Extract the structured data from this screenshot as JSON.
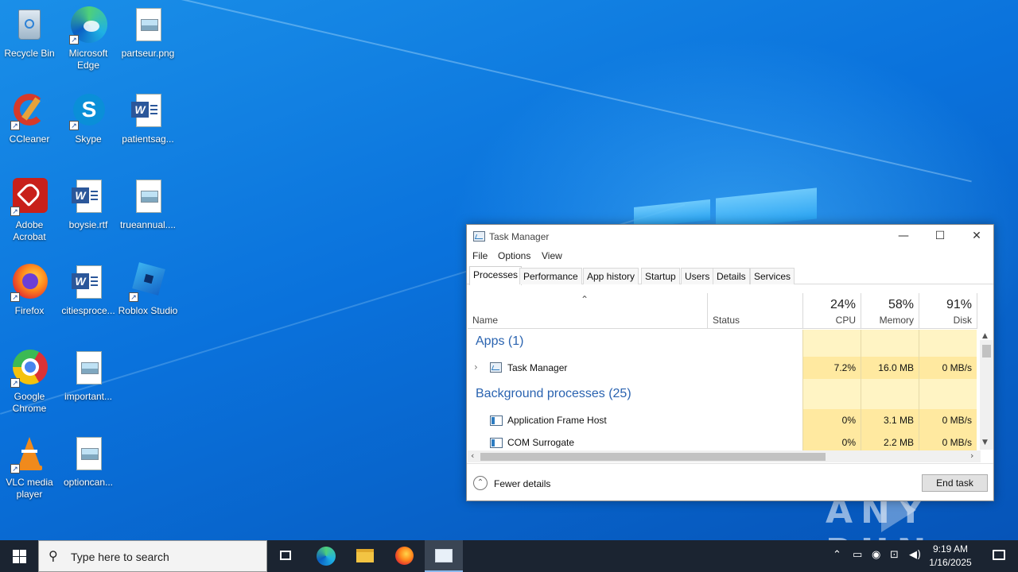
{
  "desktop": {
    "icons": [
      {
        "label": "Recycle Bin",
        "icon": "recycle-bin-icon"
      },
      {
        "label": "Microsoft Edge",
        "icon": "edge-icon"
      },
      {
        "label": "partseur.png",
        "icon": "image-file-icon"
      },
      {
        "label": "CCleaner",
        "icon": "ccleaner-icon"
      },
      {
        "label": "Skype",
        "icon": "skype-icon"
      },
      {
        "label": "patientsag...",
        "icon": "word-doc-icon"
      },
      {
        "label": "Adobe Acrobat",
        "icon": "acrobat-icon"
      },
      {
        "label": "boysie.rtf",
        "icon": "word-doc-icon"
      },
      {
        "label": "trueannual....",
        "icon": "image-file-icon"
      },
      {
        "label": "Firefox",
        "icon": "firefox-icon"
      },
      {
        "label": "citiesproce...",
        "icon": "word-doc-icon"
      },
      {
        "label": "Roblox Studio",
        "icon": "roblox-studio-icon"
      },
      {
        "label": "Google Chrome",
        "icon": "chrome-icon"
      },
      {
        "label": "important...",
        "icon": "image-file-icon"
      },
      {
        "label": "VLC media player",
        "icon": "vlc-icon"
      },
      {
        "label": "optioncan...",
        "icon": "image-file-icon"
      }
    ]
  },
  "task_manager": {
    "title": "Task Manager",
    "window_buttons": {
      "minimize": "—",
      "maximize": "☐",
      "close": "✕"
    },
    "menu": [
      "File",
      "Options",
      "View"
    ],
    "tabs": [
      "Processes",
      "Performance",
      "App history",
      "Startup",
      "Users",
      "Details",
      "Services"
    ],
    "active_tab": "Processes",
    "columns": {
      "name": "Name",
      "status": "Status",
      "cpu_pct": "24%",
      "cpu": "CPU",
      "memory_pct": "58%",
      "memory": "Memory",
      "disk_pct": "91%",
      "disk": "Disk"
    },
    "groups": {
      "apps": "Apps (1)",
      "background": "Background processes (25)"
    },
    "rows": [
      {
        "name": "Task Manager",
        "cpu": "7.2%",
        "memory": "16.0 MB",
        "disk": "0 MB/s"
      },
      {
        "name": "Application Frame Host",
        "cpu": "0%",
        "memory": "3.1 MB",
        "disk": "0 MB/s"
      },
      {
        "name": "COM Surrogate",
        "cpu": "0%",
        "memory": "2.2 MB",
        "disk": "0 MB/s"
      }
    ],
    "footer": {
      "fewer_details": "Fewer details",
      "end_task": "End task"
    }
  },
  "watermark": {
    "text": "ANY RUN"
  },
  "taskbar": {
    "search_placeholder": "Type here to search",
    "clock_time": "9:19 AM",
    "clock_date": "1/16/2025"
  }
}
